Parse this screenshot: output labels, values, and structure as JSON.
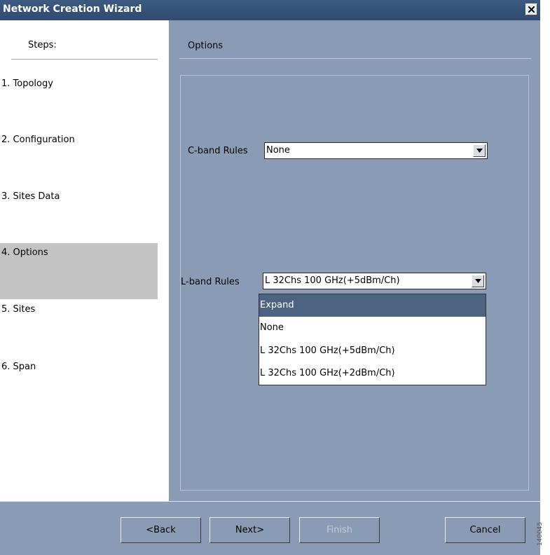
{
  "window": {
    "title": "Network Creation Wizard"
  },
  "steps": {
    "header": "Steps:",
    "items": [
      {
        "label": "1. Topology"
      },
      {
        "label": "2. Configuration"
      },
      {
        "label": "3. Sites Data"
      },
      {
        "label": "4. Options",
        "active": true
      },
      {
        "label": "5. Sites"
      },
      {
        "label": "6. Span"
      }
    ]
  },
  "options": {
    "header": "Options",
    "c_band": {
      "label": "C-band Rules",
      "value": "None"
    },
    "l_band": {
      "label": "L-band Rules",
      "value": "L 32Chs 100 GHz(+5dBm/Ch)",
      "dropdown": [
        "Expand",
        "None",
        "L 32Chs 100 GHz(+5dBm/Ch)",
        "L 32Chs 100 GHz(+2dBm/Ch)"
      ],
      "highlighted": "Expand"
    }
  },
  "buttons": {
    "back": "<Back",
    "next": "Next>",
    "finish": "Finish",
    "cancel": "Cancel"
  },
  "watermark": "140045",
  "colors": {
    "window_bg": "#8a9bb5",
    "titlebar": "#2e4a70",
    "highlight": "#4d6381",
    "active_step": "#c3c3c3"
  },
  "icons": {
    "close": "close-icon",
    "dropdown": "chevron-down-icon"
  }
}
